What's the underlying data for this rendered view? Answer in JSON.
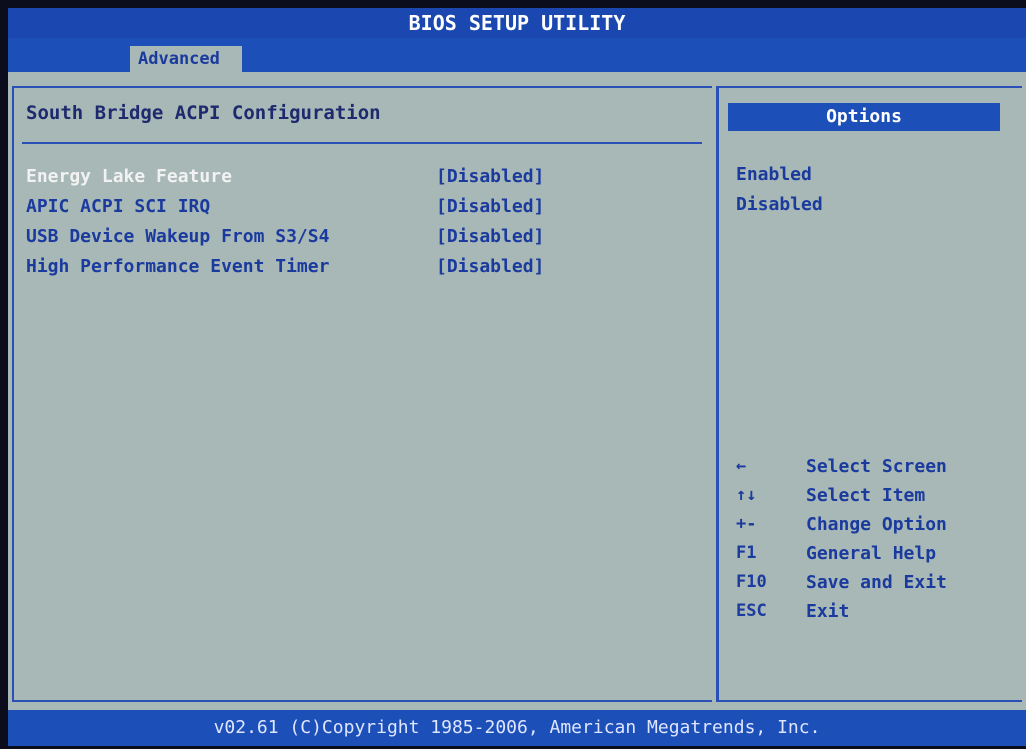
{
  "header": {
    "title": "BIOS SETUP UTILITY"
  },
  "tabs": [
    {
      "label": "Advanced"
    }
  ],
  "page": {
    "title": "South Bridge ACPI Configuration"
  },
  "settings": [
    {
      "label": "Energy Lake Feature",
      "value": "[Disabled]"
    },
    {
      "label": "APIC ACPI SCI IRQ",
      "value": "[Disabled]"
    },
    {
      "label": "USB Device Wakeup From S3/S4",
      "value": "[Disabled]"
    },
    {
      "label": "High Performance Event Timer",
      "value": "[Disabled]"
    }
  ],
  "options_panel": {
    "header": "Options",
    "items": [
      "Enabled",
      "Disabled"
    ]
  },
  "help": [
    {
      "key": "←",
      "desc": "Select Screen"
    },
    {
      "key": "↑↓",
      "desc": "Select Item"
    },
    {
      "key": "+-",
      "desc": "Change Option"
    },
    {
      "key": "F1",
      "desc": "General Help"
    },
    {
      "key": "F10",
      "desc": "Save and Exit"
    },
    {
      "key": "ESC",
      "desc": "Exit"
    }
  ],
  "footer": {
    "text": "v02.61 (C)Copyright 1985-2006, American Megatrends, Inc."
  },
  "colors": {
    "panel_bg": "#a7b8b6",
    "bar_blue": "#1c4fb8",
    "text_blue": "#1b3a9e",
    "selected_text": "#f2f2f2"
  }
}
